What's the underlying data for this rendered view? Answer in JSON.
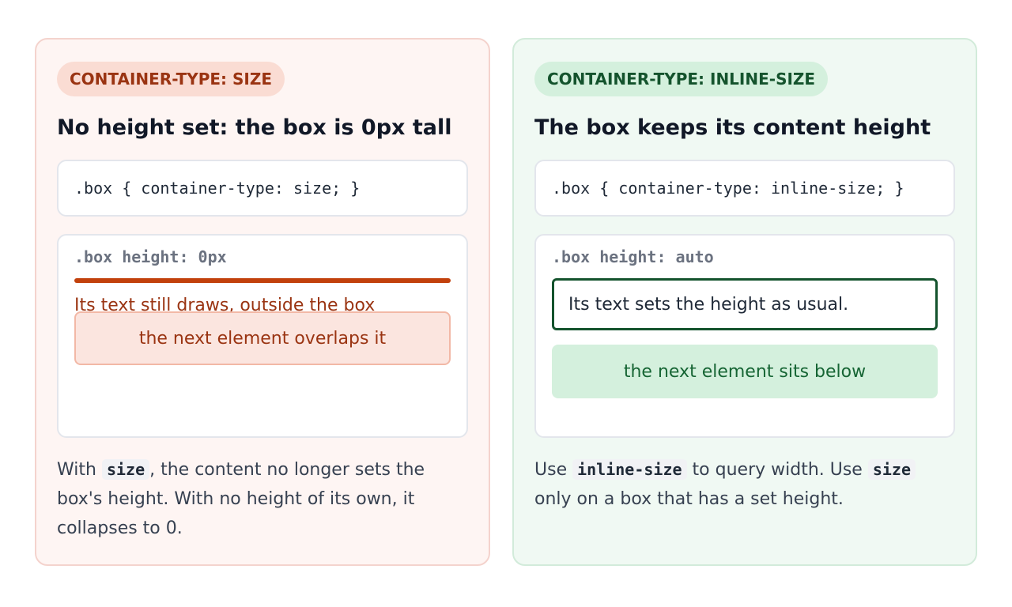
{
  "left_panel": {
    "pill": "CONTAINER-TYPE: SIZE",
    "heading": "No height set: the box is 0px tall",
    "code": ".box { container-type: size; }",
    "demo_label": ".box height: 0px",
    "overflow_text": "Its text still draws, outside the box",
    "overlap_text": "the next element overlaps it",
    "desc_before": "With ",
    "desc_code": "size",
    "desc_after": ", the content no longer sets the box's height. With no height of its own, it collapses to 0.",
    "accent_color": "#c2410c"
  },
  "right_panel": {
    "pill": "CONTAINER-TYPE: INLINE-SIZE",
    "heading": "The box keeps its content height",
    "code": ".box { container-type: inline-size; }",
    "demo_label": ".box height: auto",
    "box_text": "Its text sets the height as usual.",
    "below_text": "the next element sits below",
    "desc_1": "Use ",
    "desc_code_1": "inline-size",
    "desc_2": " to query width. Use ",
    "desc_code_2": "size",
    "desc_3": " only on a box that has a set height.",
    "accent_color": "#14532d"
  }
}
